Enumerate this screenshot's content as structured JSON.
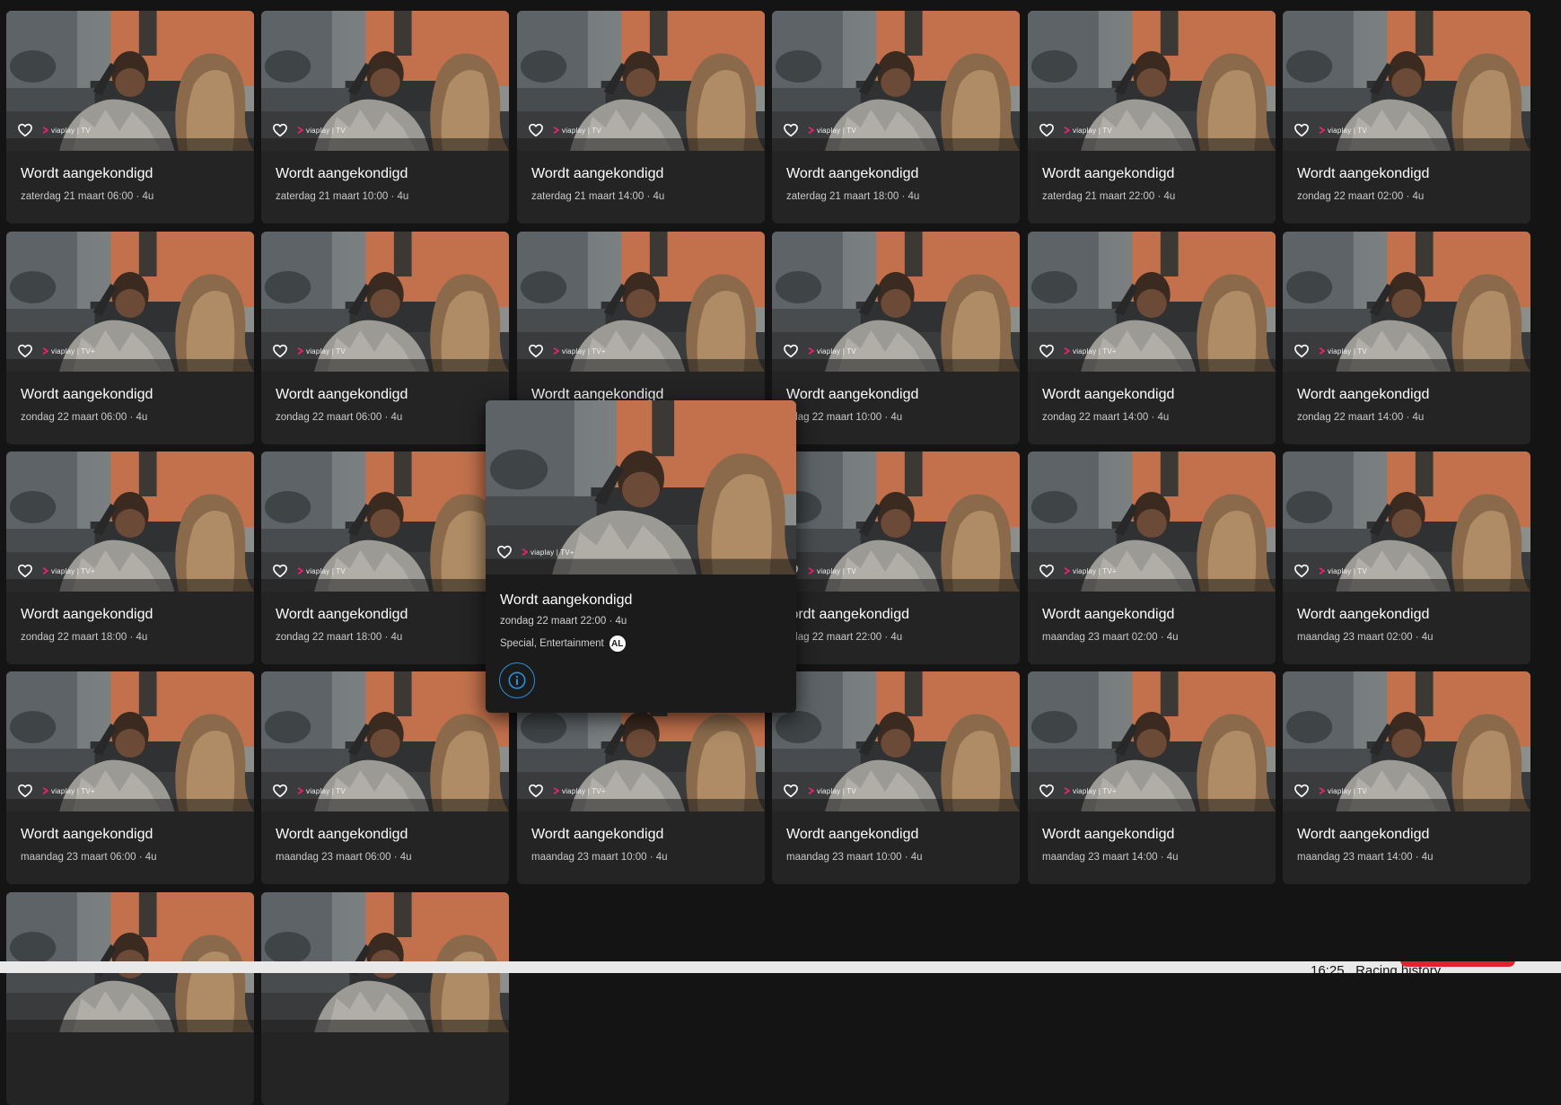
{
  "brand_label": "viaplay | TV",
  "brand_label_plus": "viaplay | TV+",
  "cards": [
    {
      "title": "Wordt aangekondigd",
      "schedule": "zaterdag 21 maart 06:00 · 4u",
      "brand": "viaplay | TV"
    },
    {
      "title": "Wordt aangekondigd",
      "schedule": "zaterdag 21 maart 10:00 · 4u",
      "brand": "viaplay | TV"
    },
    {
      "title": "Wordt aangekondigd",
      "schedule": "zaterdag 21 maart 14:00 · 4u",
      "brand": "viaplay | TV"
    },
    {
      "title": "Wordt aangekondigd",
      "schedule": "zaterdag 21 maart 18:00 · 4u",
      "brand": "viaplay | TV"
    },
    {
      "title": "Wordt aangekondigd",
      "schedule": "zaterdag 21 maart 22:00 · 4u",
      "brand": "viaplay | TV"
    },
    {
      "title": "Wordt aangekondigd",
      "schedule": "zondag 22 maart 02:00 · 4u",
      "brand": "viaplay | TV"
    },
    {
      "title": "Wordt aangekondigd",
      "schedule": "zondag 22 maart 06:00 · 4u",
      "brand": "viaplay | TV+"
    },
    {
      "title": "Wordt aangekondigd",
      "schedule": "zondag 22 maart 06:00 · 4u",
      "brand": "viaplay | TV"
    },
    {
      "title": "Wordt aangekondigd",
      "schedule": "",
      "brand": "viaplay | TV+"
    },
    {
      "title": "Wordt aangekondigd",
      "schedule": "ndag 22 maart 10:00 · 4u",
      "brand": "viaplay | TV"
    },
    {
      "title": "Wordt aangekondigd",
      "schedule": "zondag 22 maart 14:00 · 4u",
      "brand": "viaplay | TV+"
    },
    {
      "title": "Wordt aangekondigd",
      "schedule": "zondag 22 maart 14:00 · 4u",
      "brand": "viaplay | TV"
    },
    {
      "title": "Wordt aangekondigd",
      "schedule": "zondag 22 maart 18:00 · 4u",
      "brand": "viaplay | TV+"
    },
    {
      "title": "Wordt aangekondigd",
      "schedule": "zondag 22 maart 18:00 · 4u",
      "brand": "viaplay | TV"
    },
    {
      "title": "",
      "schedule": "",
      "brand": "viaplay | TV+"
    },
    {
      "title": "/ordt aangekondigd",
      "schedule": "ndag 22 maart 22:00 · 4u",
      "brand": "viaplay | TV"
    },
    {
      "title": "Wordt aangekondigd",
      "schedule": "maandag 23 maart 02:00 · 4u",
      "brand": "viaplay | TV+"
    },
    {
      "title": "Wordt aangekondigd",
      "schedule": "maandag 23 maart 02:00 · 4u",
      "brand": "viaplay | TV"
    },
    {
      "title": "Wordt aangekondigd",
      "schedule": "maandag 23 maart 06:00 · 4u",
      "brand": "viaplay | TV+"
    },
    {
      "title": "Wordt aangekondigd",
      "schedule": "maandag 23 maart 06:00 · 4u",
      "brand": "viaplay | TV"
    },
    {
      "title": "Wordt aangekondigd",
      "schedule": "maandag 23 maart 10:00 · 4u",
      "brand": "viaplay | TV+"
    },
    {
      "title": "Wordt aangekondigd",
      "schedule": "maandag 23 maart 10:00 · 4u",
      "brand": "viaplay | TV"
    },
    {
      "title": "Wordt aangekondigd",
      "schedule": "maandag 23 maart 14:00 · 4u",
      "brand": "viaplay | TV+"
    },
    {
      "title": "Wordt aangekondigd",
      "schedule": "maandag 23 maart 14:00 · 4u",
      "brand": "viaplay | TV"
    },
    {
      "title": "",
      "schedule": "",
      "brand": ""
    },
    {
      "title": "",
      "schedule": "",
      "brand": ""
    }
  ],
  "popover": {
    "title": "Wordt aangekondigd",
    "schedule": "zondag 22 maart 22:00 · 4u",
    "genre": "Special, Entertainment",
    "rating": "AL",
    "brand": "viaplay | TV+",
    "info_icon": "info-icon"
  },
  "taskbar": {
    "clock": "16:25",
    "text": "Racing history"
  },
  "colors": {
    "background": "#141414",
    "card": "#242424",
    "popover": "#1b1b1b",
    "accent_blue": "#2b8fd9",
    "viaplay_pink": "#e8226e",
    "taskbar_red": "#e0232e"
  }
}
